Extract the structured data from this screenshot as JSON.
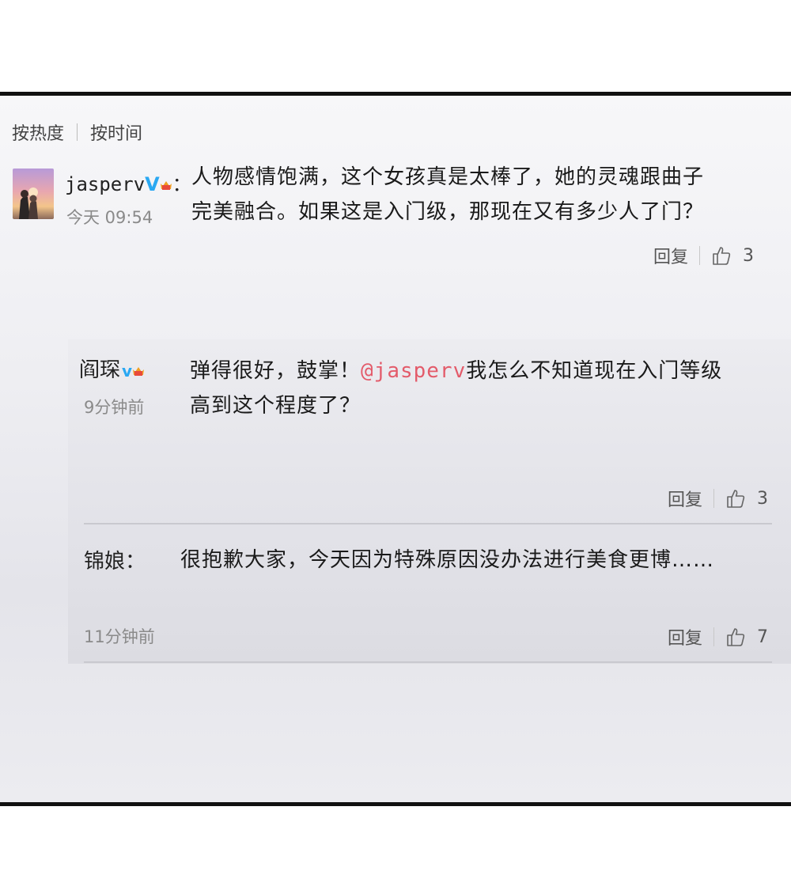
{
  "sort": {
    "hot_label": "按热度",
    "time_label": "按时间"
  },
  "comment": {
    "username": "jasperv",
    "verified": "V",
    "colon": "：",
    "time": "今天 09:54",
    "text_line1": "人物感情饱满，这个女孩真是太棒了，她的灵魂跟曲子",
    "text_line2": "完美融合。如果这是入门级，那现在又有多少人了门？",
    "reply_label": "回复",
    "likes": "3"
  },
  "replies": [
    {
      "username": "阎琛",
      "verified": "v",
      "time": "9分钟前",
      "text_before": "弹得很好，鼓掌！",
      "mention": "@jasperv",
      "text_after": "我怎么不知道现在入门等级",
      "text_line2": "高到这个程度了？",
      "reply_label": "回复",
      "likes": "3"
    },
    {
      "username": "锦娘：",
      "time": "11分钟前",
      "text": "很抱歉大家，今天因为特殊原因没办法进行美食更博……",
      "reply_label": "回复",
      "likes": "7"
    }
  ],
  "icons": {
    "thumb": "thumbs-up-icon",
    "crown": "crown-badge-icon",
    "verified": "verified-v-icon"
  },
  "colors": {
    "mention": "#e35b6a",
    "verified": "#2aa8f2"
  }
}
